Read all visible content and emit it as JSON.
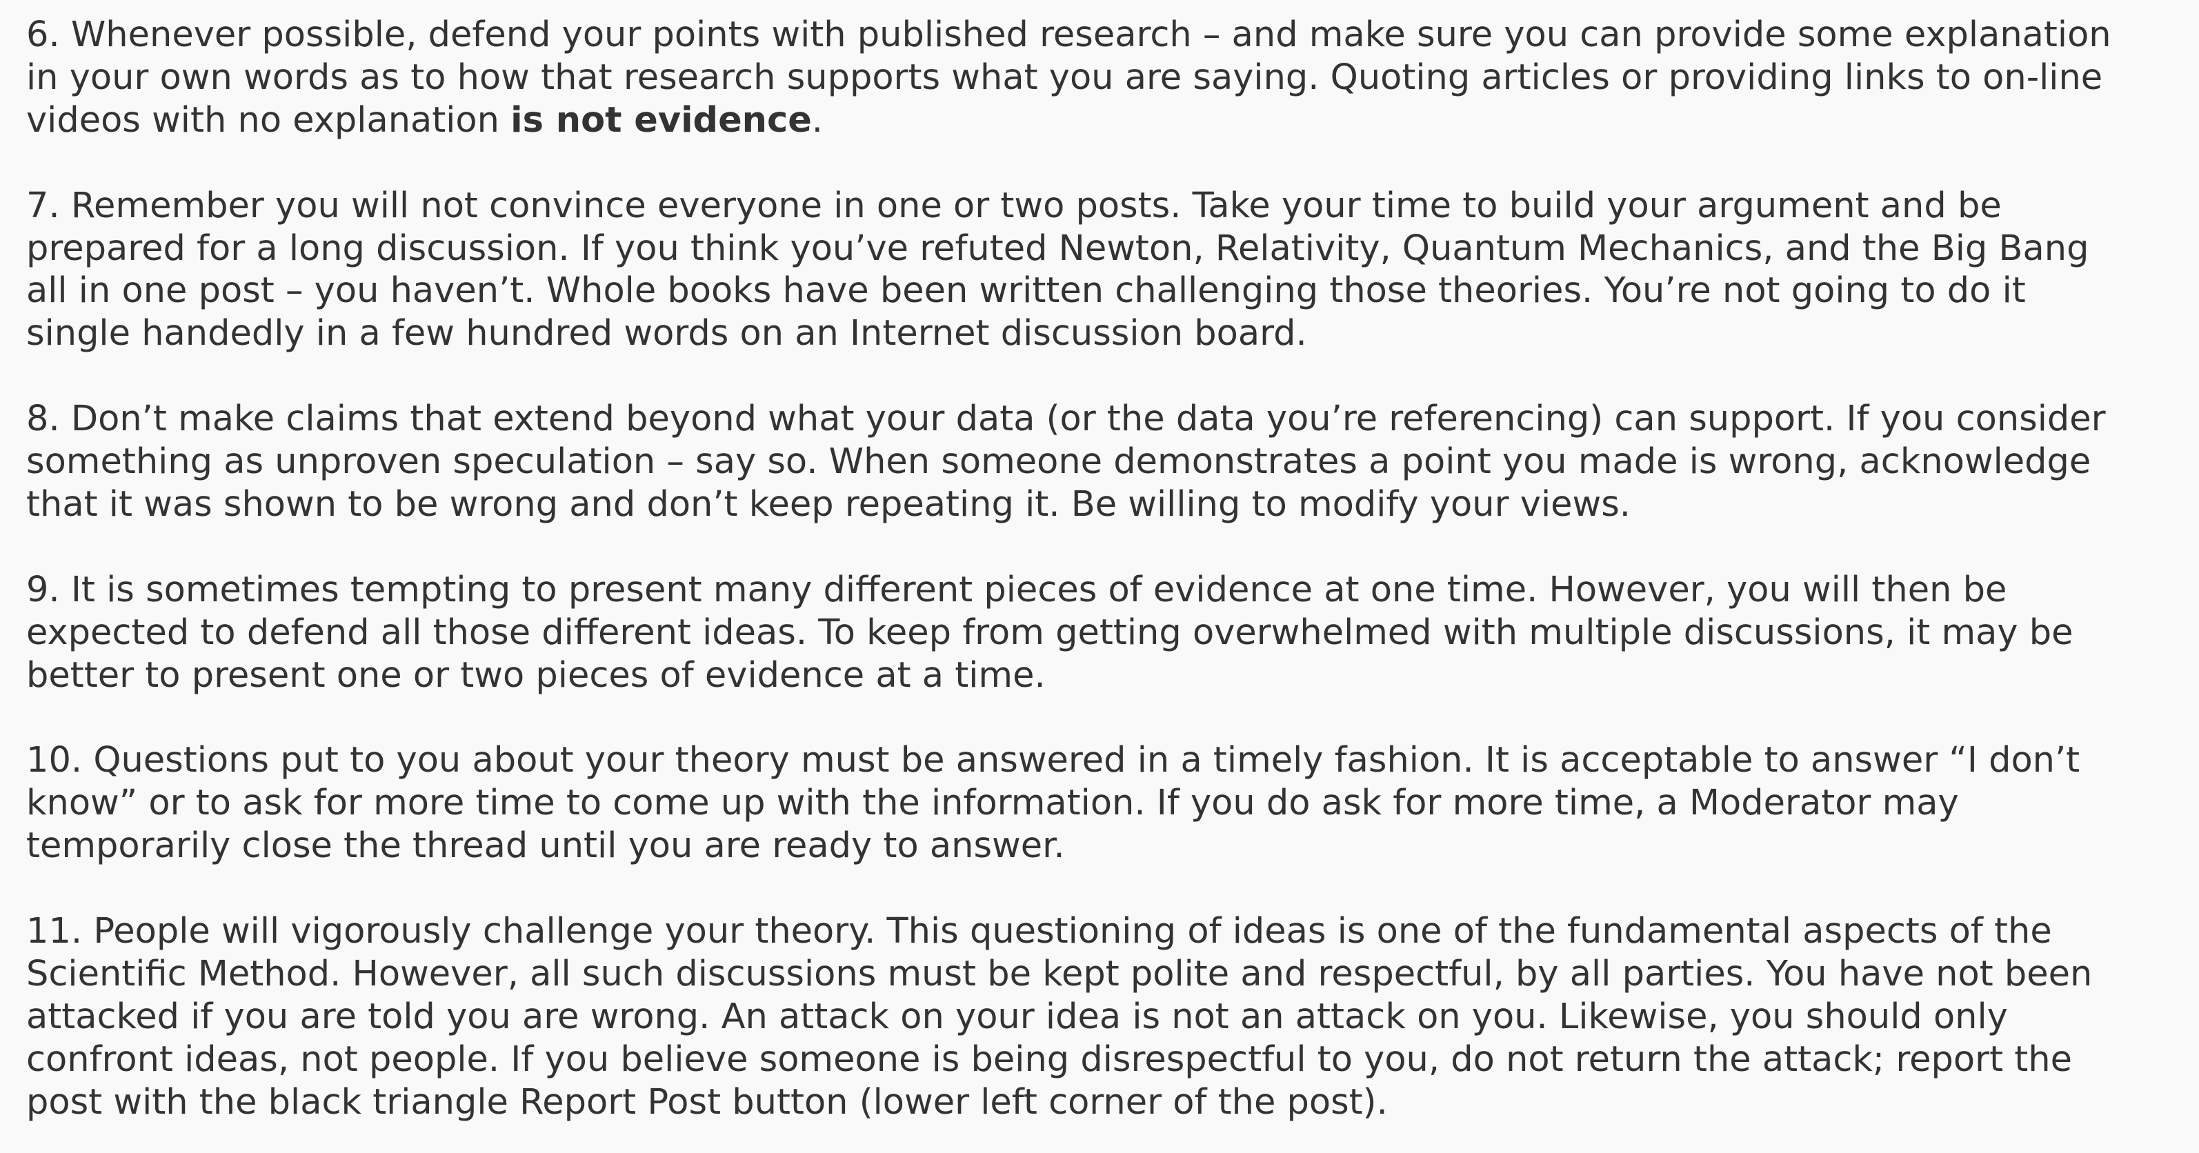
{
  "rules": [
    {
      "number": "6.",
      "lines": [
        "6. Whenever possible, defend your points with published research – and make sure you can provide some explanation",
        "in your own words as to how that research supports what you are saying. Quoting articles or providing links to on-line"
      ],
      "last_line_before": "videos with no explanation ",
      "last_line_bold": "is not evidence",
      "last_line_after": "."
    },
    {
      "number": "7.",
      "lines": [
        "7. Remember you will not convince everyone in one or two posts. Take your time to build your argument and be",
        "prepared for a long discussion. If you think you’ve refuted Newton, Relativity, Quantum Mechanics, and the Big Bang",
        "all in one post – you haven’t. Whole books have been written challenging those theories. You’re not going to do it",
        "single handedly in a few hundred words on an Internet discussion board."
      ]
    },
    {
      "number": "8.",
      "lines": [
        "8. Don’t make claims that extend beyond what your data (or the data you’re referencing) can support. If you consider",
        "something as unproven speculation – say so. When someone demonstrates a point you made is wrong, acknowledge",
        "that it was shown to be wrong and don’t keep repeating it. Be willing to modify your views."
      ]
    },
    {
      "number": "9.",
      "lines": [
        "9. It is sometimes tempting to present many different pieces of evidence at one time. However, you will then be",
        "expected to defend all those different ideas. To keep from getting overwhelmed with multiple discussions, it may be",
        "better to present one or two pieces of evidence at a time."
      ]
    },
    {
      "number": "10.",
      "lines": [
        "10. Questions put to you about your theory must be answered in a timely fashion. It is acceptable to answer “I don’t",
        "know” or to ask for more time to come up with the information. If you do ask for more time, a Moderator may",
        "temporarily close the thread until you are ready to answer."
      ]
    },
    {
      "number": "11.",
      "lines": [
        "11. People will vigorously challenge your theory. This questioning of ideas is one of the fundamental aspects of the",
        "Scientific Method. However, all such discussions must be kept polite and respectful, by all parties. You have not been",
        "attacked if you are told you are wrong. An attack on your idea is not an attack on you. Likewise, you should only",
        "confront ideas, not people. If you believe someone is being disrespectful to you, do not return the attack; report the",
        "post with the black triangle Report Post button (lower left corner of the post)."
      ]
    }
  ]
}
